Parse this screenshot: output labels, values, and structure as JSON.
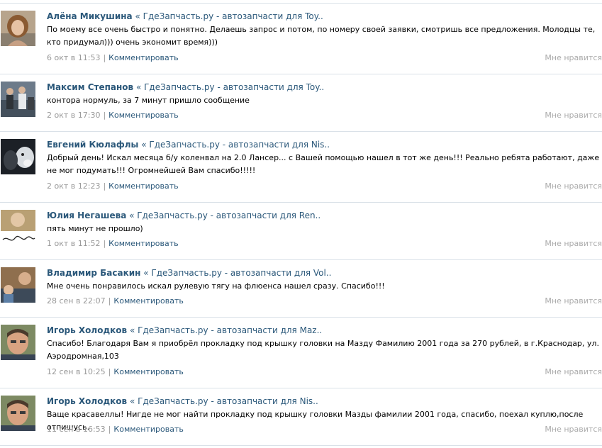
{
  "comments": [
    {
      "author": "Алёна Микушина",
      "source": "ГдеЗапчасть.ру - автозапчасти для Toy..",
      "text": "По моему все очень быстро и понятно. Делаешь запрос и потом, по номеру своей заявки, смотришь все предложения. Молодцы те, кто придумал))) очень экономит время)))",
      "date": "6 окт в 11:53",
      "reply": "Комментировать",
      "like": "Мне нравится"
    },
    {
      "author": "Максим Степанов",
      "source": "ГдеЗапчасть.ру - автозапчасти для Toy..",
      "text": "контора нормуль, за 7 минут пришло сообщение",
      "date": "2 окт в 17:30",
      "reply": "Комментировать",
      "like": "Мне нравится"
    },
    {
      "author": "Евгений Кюлафлы",
      "source": "ГдеЗапчасть.ру - автозапчасти для Nis..",
      "text": "Добрый день! Искал месяца б/у коленвал на 2.0 Лансер... с Вашей помощью нашел в тот же день!!! Реально ребята работают, даже не мог подумать!!! Огромнейшей Вам спасибо!!!!!",
      "date": "2 окт в 12:23",
      "reply": "Комментировать",
      "like": "Мне нравится"
    },
    {
      "author": "Юлия Негашева",
      "source": "ГдеЗапчасть.ру - автозапчасти для Ren..",
      "text": "пять минут не прошло)",
      "date": "1 окт в 11:52",
      "reply": "Комментировать",
      "like": "Мне нравится"
    },
    {
      "author": "Владимир Басакин",
      "source": "ГдеЗапчасть.ру - автозапчасти для Vol..",
      "text": "Мне очень понравилось искал рулевую тягу на флюенса нашел сразу. Спасибо!!!",
      "date": "28 сен в 22:07",
      "reply": "Комментировать",
      "like": "Мне нравится"
    },
    {
      "author": "Игорь Холодков",
      "source": "ГдеЗапчасть.ру - автозапчасти для Maz..",
      "text": "Спасибо! Благодаря Вам я приобрёл прокладку под крышку головки на Мазду Фамилию 2001 года за 270 рублей, в г.Краснодар, ул. Аэродромная,103",
      "date": "12 сен в 10:25",
      "reply": "Комментировать",
      "like": "Мне нравится"
    },
    {
      "author": "Игорь Холодков",
      "source": "ГдеЗапчасть.ру - автозапчасти для Nis..",
      "text": "Ваще красавеллы! Нигде не мог найти прокладку под крышку головки Мазды фамилии 2001 года, спасибо, поехал куплю,после отпишусь.",
      "date": "11 сен в 16:53",
      "reply": "Комментировать",
      "like": "Мне нравится"
    }
  ]
}
